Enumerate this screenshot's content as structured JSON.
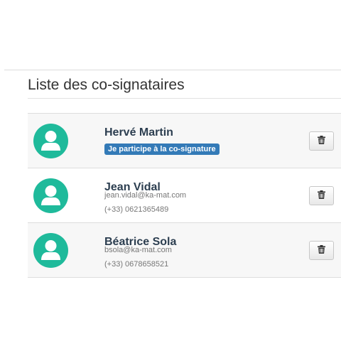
{
  "panel": {
    "title": "Liste des co-signataires"
  },
  "cosigners": [
    {
      "name": "Hervé Martin",
      "badge": "Je participe à la co-signature",
      "avatar_icon": "user-icon",
      "action_icon": "trash-icon"
    },
    {
      "name": "Jean Vidal",
      "email": "jean.vidal@ka-mat.com",
      "phone": "(+33) 0621365489",
      "avatar_icon": "user-icon",
      "action_icon": "trash-icon"
    },
    {
      "name": "Béatrice Sola",
      "email": "bsola@ka-mat.com",
      "phone": "(+33) 0678658521",
      "avatar_icon": "user-icon",
      "action_icon": "trash-icon"
    }
  ],
  "colors": {
    "avatar_bg": "#1fba9b",
    "badge_bg": "#337ab7",
    "name_text": "#2c3e50"
  }
}
